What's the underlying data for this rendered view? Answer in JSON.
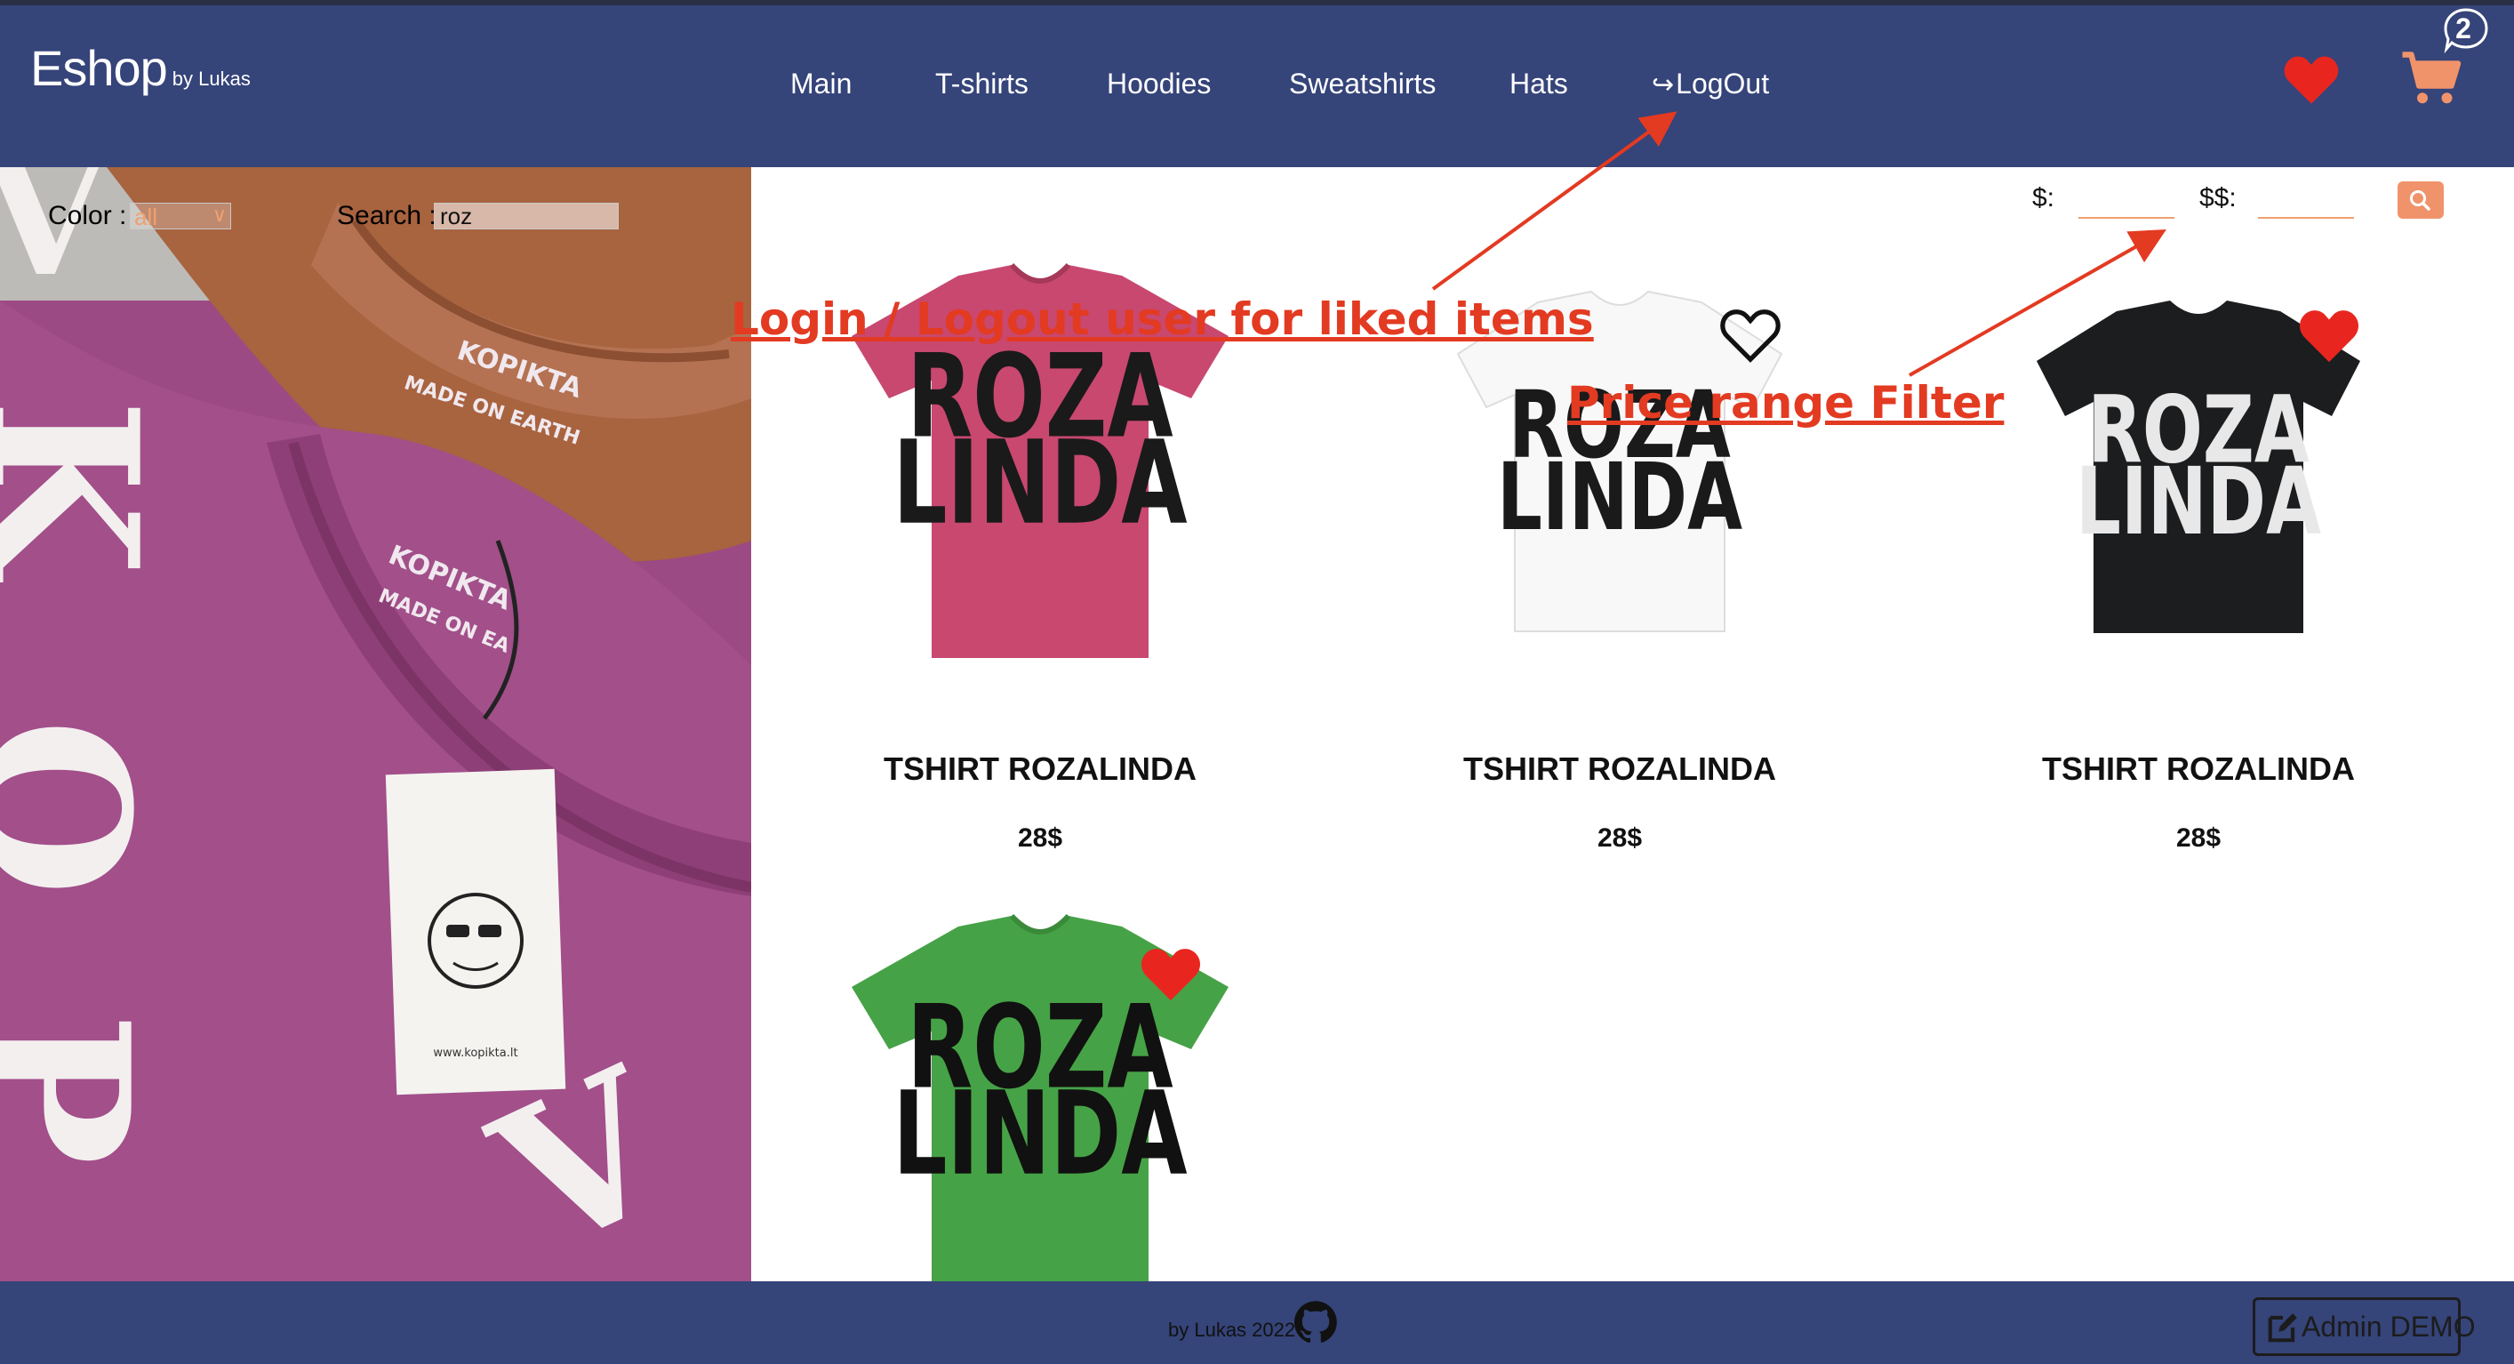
{
  "header": {
    "brand_name": "Eshop",
    "brand_by": "by Lukas",
    "nav": [
      {
        "label": "Main"
      },
      {
        "label": "T-shirts"
      },
      {
        "label": "Hoodies"
      },
      {
        "label": "Sweatshirts"
      },
      {
        "label": "Hats"
      },
      {
        "label": "LogOut",
        "icon": "sign-out-icon"
      }
    ],
    "cart_count": "2",
    "icons": {
      "wishlist": "heart-icon",
      "cart": "shopping-cart-icon"
    }
  },
  "filters": {
    "color_label": "Color :",
    "color_value": "all",
    "search_label": "Search :",
    "search_value": "roz",
    "min_price_label": "$:",
    "max_price_label": "$$:",
    "min_price_value": "",
    "max_price_value": "",
    "search_button_icon": "search-icon"
  },
  "hero_image": {
    "brand_print": [
      "KOPIKTA",
      "MADE ON EARTH"
    ],
    "tag_url": "www.kopikta.lt"
  },
  "products": [
    {
      "title": "TSHIRT ROZALINDA",
      "price": "28$",
      "shirt_color": "#c84870",
      "print_color": "#1a1a1a",
      "liked": false,
      "print_lines": [
        "ROZA",
        "LINDA"
      ]
    },
    {
      "title": "TSHIRT ROZALINDA",
      "price": "28$",
      "shirt_color": "#f8f8f8",
      "print_color": "#1a1a1a",
      "liked": false,
      "print_lines": [
        "ROZA",
        "LINDA"
      ]
    },
    {
      "title": "TSHIRT ROZALINDA",
      "price": "28$",
      "shirt_color": "#1b1d1f",
      "print_color": "#e8e8e8",
      "liked": true,
      "print_lines": [
        "ROZA",
        "LINDA"
      ]
    },
    {
      "title": "",
      "price": "",
      "shirt_color": "#46a246",
      "print_color": "#111111",
      "liked": true,
      "print_lines": [
        "ROZA",
        "LINDA"
      ]
    }
  ],
  "annotations": {
    "login": "Login / Logout user for liked items",
    "price": "Price range Filter"
  },
  "footer": {
    "credit": "by Lukas 2022",
    "github_icon": "github-icon",
    "admin_label": "Admin DEMO",
    "admin_icon": "edit-icon"
  },
  "colors": {
    "header_bg": "#354479",
    "accent": "#f0936b",
    "like_red": "#e8261f",
    "annotation_red": "#e33a22"
  }
}
